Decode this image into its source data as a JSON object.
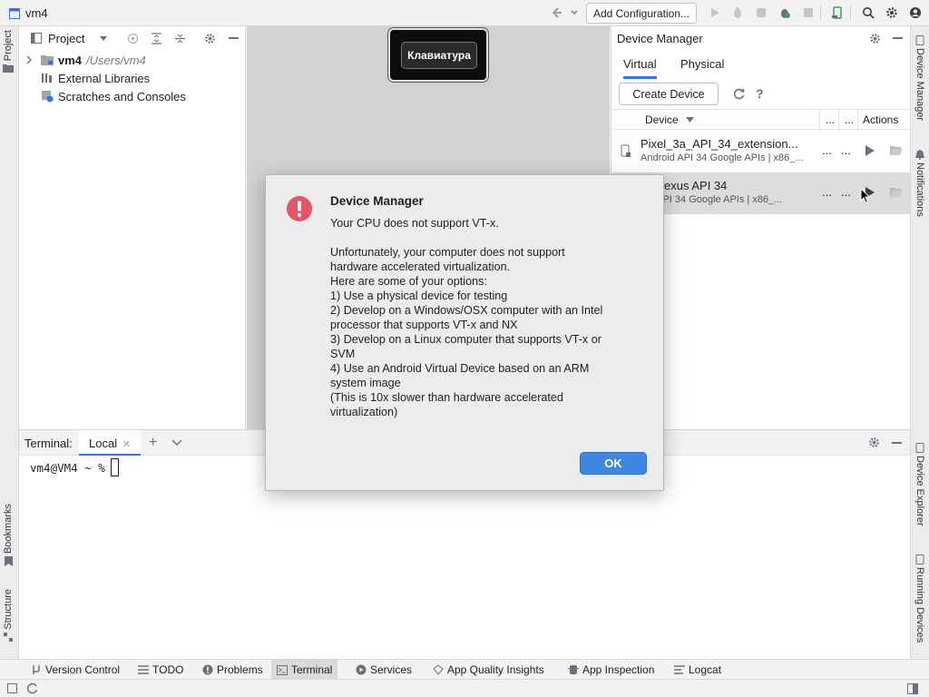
{
  "titlebar": {
    "project_name": "vm4",
    "add_config_label": "Add Configuration..."
  },
  "left_strip": {
    "project_label": "Project",
    "bookmarks_label": "Bookmarks",
    "structure_label": "Structure"
  },
  "right_strip": {
    "device_manager_label": "Device Manager",
    "notifications_label": "Notifications",
    "device_explorer_label": "Device Explorer",
    "running_devices_label": "Running Devices"
  },
  "project_panel": {
    "header_label": "Project",
    "tree": [
      {
        "name": "vm4",
        "path": "/Users/vm4"
      },
      {
        "name": "External Libraries"
      },
      {
        "name": "Scratches and Consoles"
      }
    ]
  },
  "editor": {
    "keyboard_popup_label": "Клавиатура"
  },
  "device_manager": {
    "title": "Device Manager",
    "tabs": [
      "Virtual",
      "Physical"
    ],
    "create_device_label": "Create Device",
    "columns": {
      "device": "Device",
      "col2": "...",
      "col3": "...",
      "actions": "Actions"
    },
    "devices": [
      {
        "name": "Pixel_3a_API_34_extension...",
        "subtitle": "Android API 34 Google APIs | x86_...",
        "more1": "...",
        "more2": "..."
      },
      {
        "name": "xy Nexus API 34",
        "subtitle": "oid API 34 Google APIs | x86_...",
        "more1": "...",
        "more2": "..."
      }
    ]
  },
  "terminal": {
    "label": "Terminal:",
    "tab_label": "Local",
    "prompt": "vm4@VM4 ~ %"
  },
  "toolwindows": [
    {
      "label": "Version Control",
      "icon": "version-control-icon"
    },
    {
      "label": "TODO",
      "icon": "list-icon"
    },
    {
      "label": "Problems",
      "icon": "problems-icon"
    },
    {
      "label": "Terminal",
      "icon": "terminal-icon"
    },
    {
      "label": "Services",
      "icon": "services-icon"
    },
    {
      "label": "App Quality Insights",
      "icon": "diamond-icon"
    },
    {
      "label": "App Inspection",
      "icon": "inspection-icon"
    },
    {
      "label": "Logcat",
      "icon": "logcat-icon"
    }
  ],
  "dialog": {
    "title": "Device Manager",
    "message": "Your CPU does not support VT-x.",
    "body": "Unfortunately, your computer does not support\nhardware accelerated virtualization.\nHere are some of your options:\n1) Use a physical device for testing\n2) Develop on a Windows/OSX computer with an Intel\nprocessor that supports VT-x and NX\n3) Develop on a Linux computer that supports VT-x or\nSVM\n4) Use an Android Virtual Device based on an ARM\nsystem image\n(This is 10x slower than hardware accelerated\nvirtualization)",
    "ok_label": "OK"
  },
  "colors": {
    "accent": "#3574f0",
    "ok_button": "#3f87e0",
    "error_icon": "#e55765",
    "selected_row": "#dcdcdc"
  }
}
